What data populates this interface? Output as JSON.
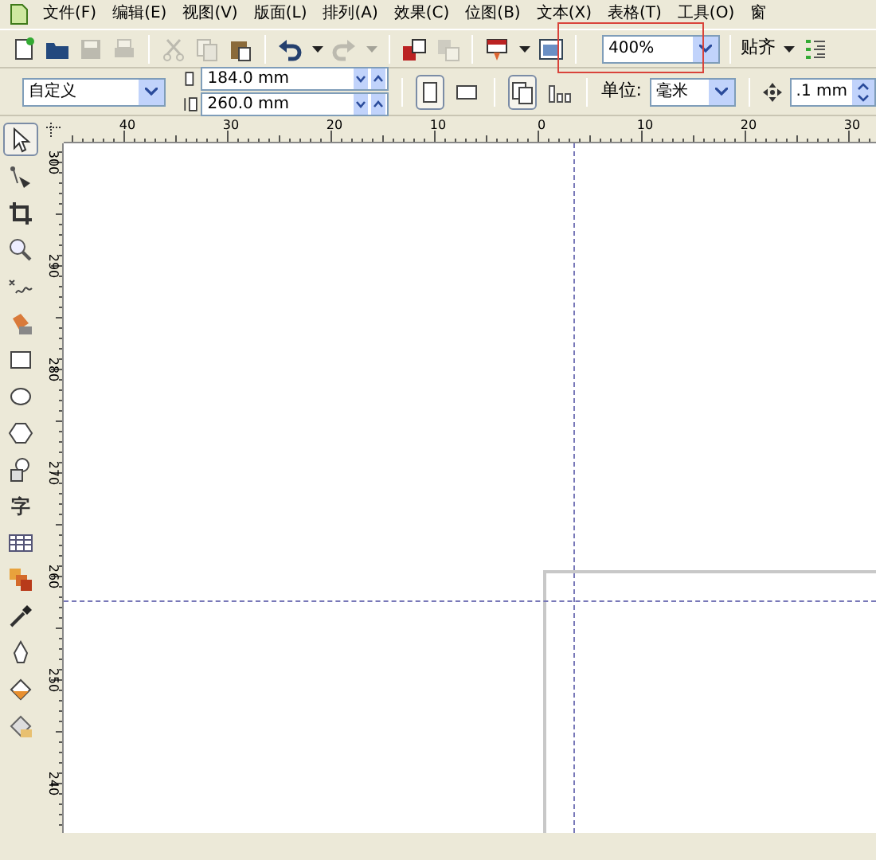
{
  "menu": [
    "文件(F)",
    "编辑(E)",
    "视图(V)",
    "版面(L)",
    "排列(A)",
    "效果(C)",
    "位图(B)",
    "文本(X)",
    "表格(T)",
    "工具(O)",
    "窗"
  ],
  "toolbar": [
    {
      "kind": "new",
      "disabled": false
    },
    {
      "kind": "open",
      "disabled": false
    },
    {
      "kind": "save",
      "disabled": true
    },
    {
      "kind": "print",
      "disabled": true
    },
    {
      "kind": "sep"
    },
    {
      "kind": "cut",
      "disabled": true
    },
    {
      "kind": "copy",
      "disabled": true
    },
    {
      "kind": "paste",
      "disabled": false
    },
    {
      "kind": "sep"
    },
    {
      "kind": "undo",
      "disabled": false
    },
    {
      "kind": "caret",
      "disabled": false
    },
    {
      "kind": "redo",
      "disabled": true
    },
    {
      "kind": "caret",
      "disabled": true
    },
    {
      "kind": "sep"
    },
    {
      "kind": "import",
      "disabled": false
    },
    {
      "kind": "export",
      "disabled": true
    },
    {
      "kind": "sep"
    },
    {
      "kind": "launcher",
      "disabled": false
    },
    {
      "kind": "caret",
      "disabled": false
    },
    {
      "kind": "welcome",
      "disabled": false
    },
    {
      "kind": "sep"
    },
    {
      "kind": "zoom",
      "value": "400%",
      "highlighted": true
    },
    {
      "kind": "sep"
    },
    {
      "kind": "snap",
      "label": "贴齐"
    },
    {
      "kind": "caret",
      "disabled": false
    },
    {
      "kind": "options",
      "disabled": false
    }
  ],
  "property_bar": {
    "page_size": "自定义",
    "width": "184.0 mm",
    "height": "260.0 mm",
    "orientation": [
      {
        "kind": "portrait",
        "selected": true
      },
      {
        "kind": "landscape",
        "selected": false
      }
    ],
    "layout": [
      {
        "kind": "all-pages",
        "selected": true
      },
      {
        "kind": "current-page",
        "selected": false
      }
    ],
    "units_label": "单位:",
    "units": "毫米",
    "nudge": ".1 mm"
  },
  "ruler_h": [
    "40",
    "30",
    "20",
    "10",
    "0",
    "10",
    "20",
    "30"
  ],
  "ruler_v": [
    "300",
    "290",
    "280",
    "270",
    "260",
    "250",
    "240"
  ],
  "toolbox": [
    {
      "kind": "pick",
      "selected": true
    },
    {
      "kind": "shape",
      "selected": false
    },
    {
      "kind": "crop",
      "selected": false
    },
    {
      "kind": "zoom",
      "selected": false
    },
    {
      "kind": "freehand",
      "selected": false
    },
    {
      "kind": "smart-fill",
      "selected": false
    },
    {
      "kind": "rectangle",
      "selected": false
    },
    {
      "kind": "ellipse",
      "selected": false
    },
    {
      "kind": "polygon",
      "selected": false
    },
    {
      "kind": "basic-shapes",
      "selected": false
    },
    {
      "kind": "text",
      "label": "字",
      "selected": false
    },
    {
      "kind": "table",
      "selected": false
    },
    {
      "kind": "interactive",
      "selected": false
    },
    {
      "kind": "eyedropper",
      "selected": false
    },
    {
      "kind": "outline",
      "selected": false
    },
    {
      "kind": "fill",
      "selected": false
    },
    {
      "kind": "interactive-fill",
      "selected": false
    }
  ]
}
